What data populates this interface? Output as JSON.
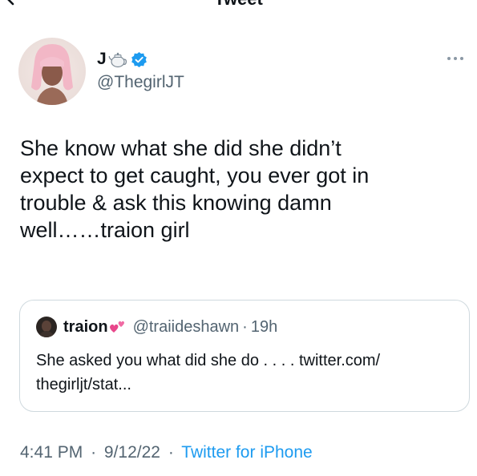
{
  "header": {
    "title": "Tweet"
  },
  "author": {
    "display_name": "J",
    "handle": "@ThegirlJT",
    "verified": true
  },
  "tweet": {
    "text": "She know what she did she didn’t\nexpect to get caught, you ever got in\ntrouble & ask this knowing damn\nwell……traion girl",
    "time": "4:41 PM",
    "date": "9/12/22",
    "separator": "·",
    "source": "Twitter for iPhone"
  },
  "quote": {
    "display_name": "traion",
    "handle": "@traiideshawn",
    "separator": "·",
    "time": "19h",
    "text": "She asked you what did she do . . . . twitter.com/ thegirljt/stat..."
  },
  "colors": {
    "text_primary": "#0f1419",
    "text_secondary": "#536471",
    "accent_blue": "#1d9bf0",
    "border": "#cfd9de",
    "heart_pink": "#e8478b"
  },
  "icons": {
    "back": "chevron-left-icon",
    "teapot": "teapot-emoji-icon",
    "verified": "verified-badge-icon",
    "more": "more-horizontal-icon",
    "heart": "two-hearts-emoji-icon"
  }
}
